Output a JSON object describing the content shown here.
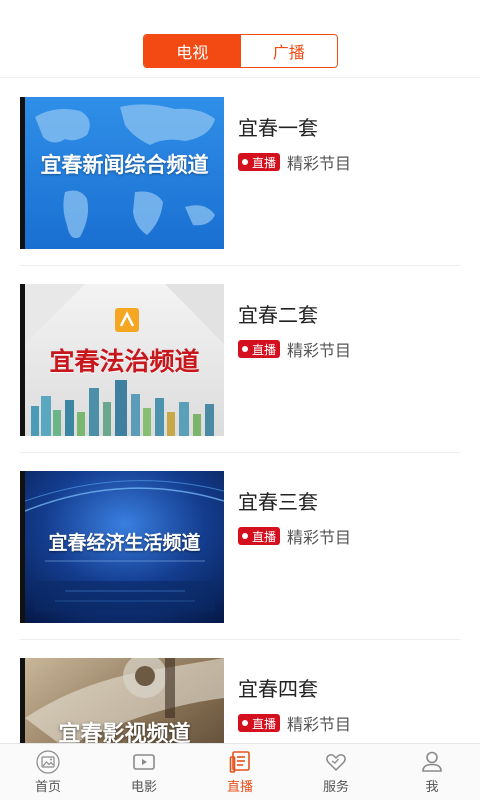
{
  "segment": {
    "tv_label": "电视",
    "radio_label": "广播"
  },
  "channels": [
    {
      "name": "宜春一套",
      "badge": "直播",
      "program": "精彩节目",
      "thumb_text": "宜春新闻综合频道"
    },
    {
      "name": "宜春二套",
      "badge": "直播",
      "program": "精彩节目",
      "thumb_text": "宜春法治频道"
    },
    {
      "name": "宜春三套",
      "badge": "直播",
      "program": "精彩节目",
      "thumb_text": "宜春经济生活频道"
    },
    {
      "name": "宜春四套",
      "badge": "直播",
      "program": "精彩节目",
      "thumb_text": "宜春影视频道"
    }
  ],
  "tabbar": {
    "items": [
      {
        "label": "首页",
        "icon": "image-icon"
      },
      {
        "label": "电影",
        "icon": "play-icon"
      },
      {
        "label": "直播",
        "icon": "live-tv-icon"
      },
      {
        "label": "服务",
        "icon": "heart-icon"
      },
      {
        "label": "我",
        "icon": "person-icon"
      }
    ],
    "active": "直播"
  },
  "colors": {
    "accent": "#f24a12",
    "badge": "#d4101e",
    "tab_active": "#e8501b"
  }
}
